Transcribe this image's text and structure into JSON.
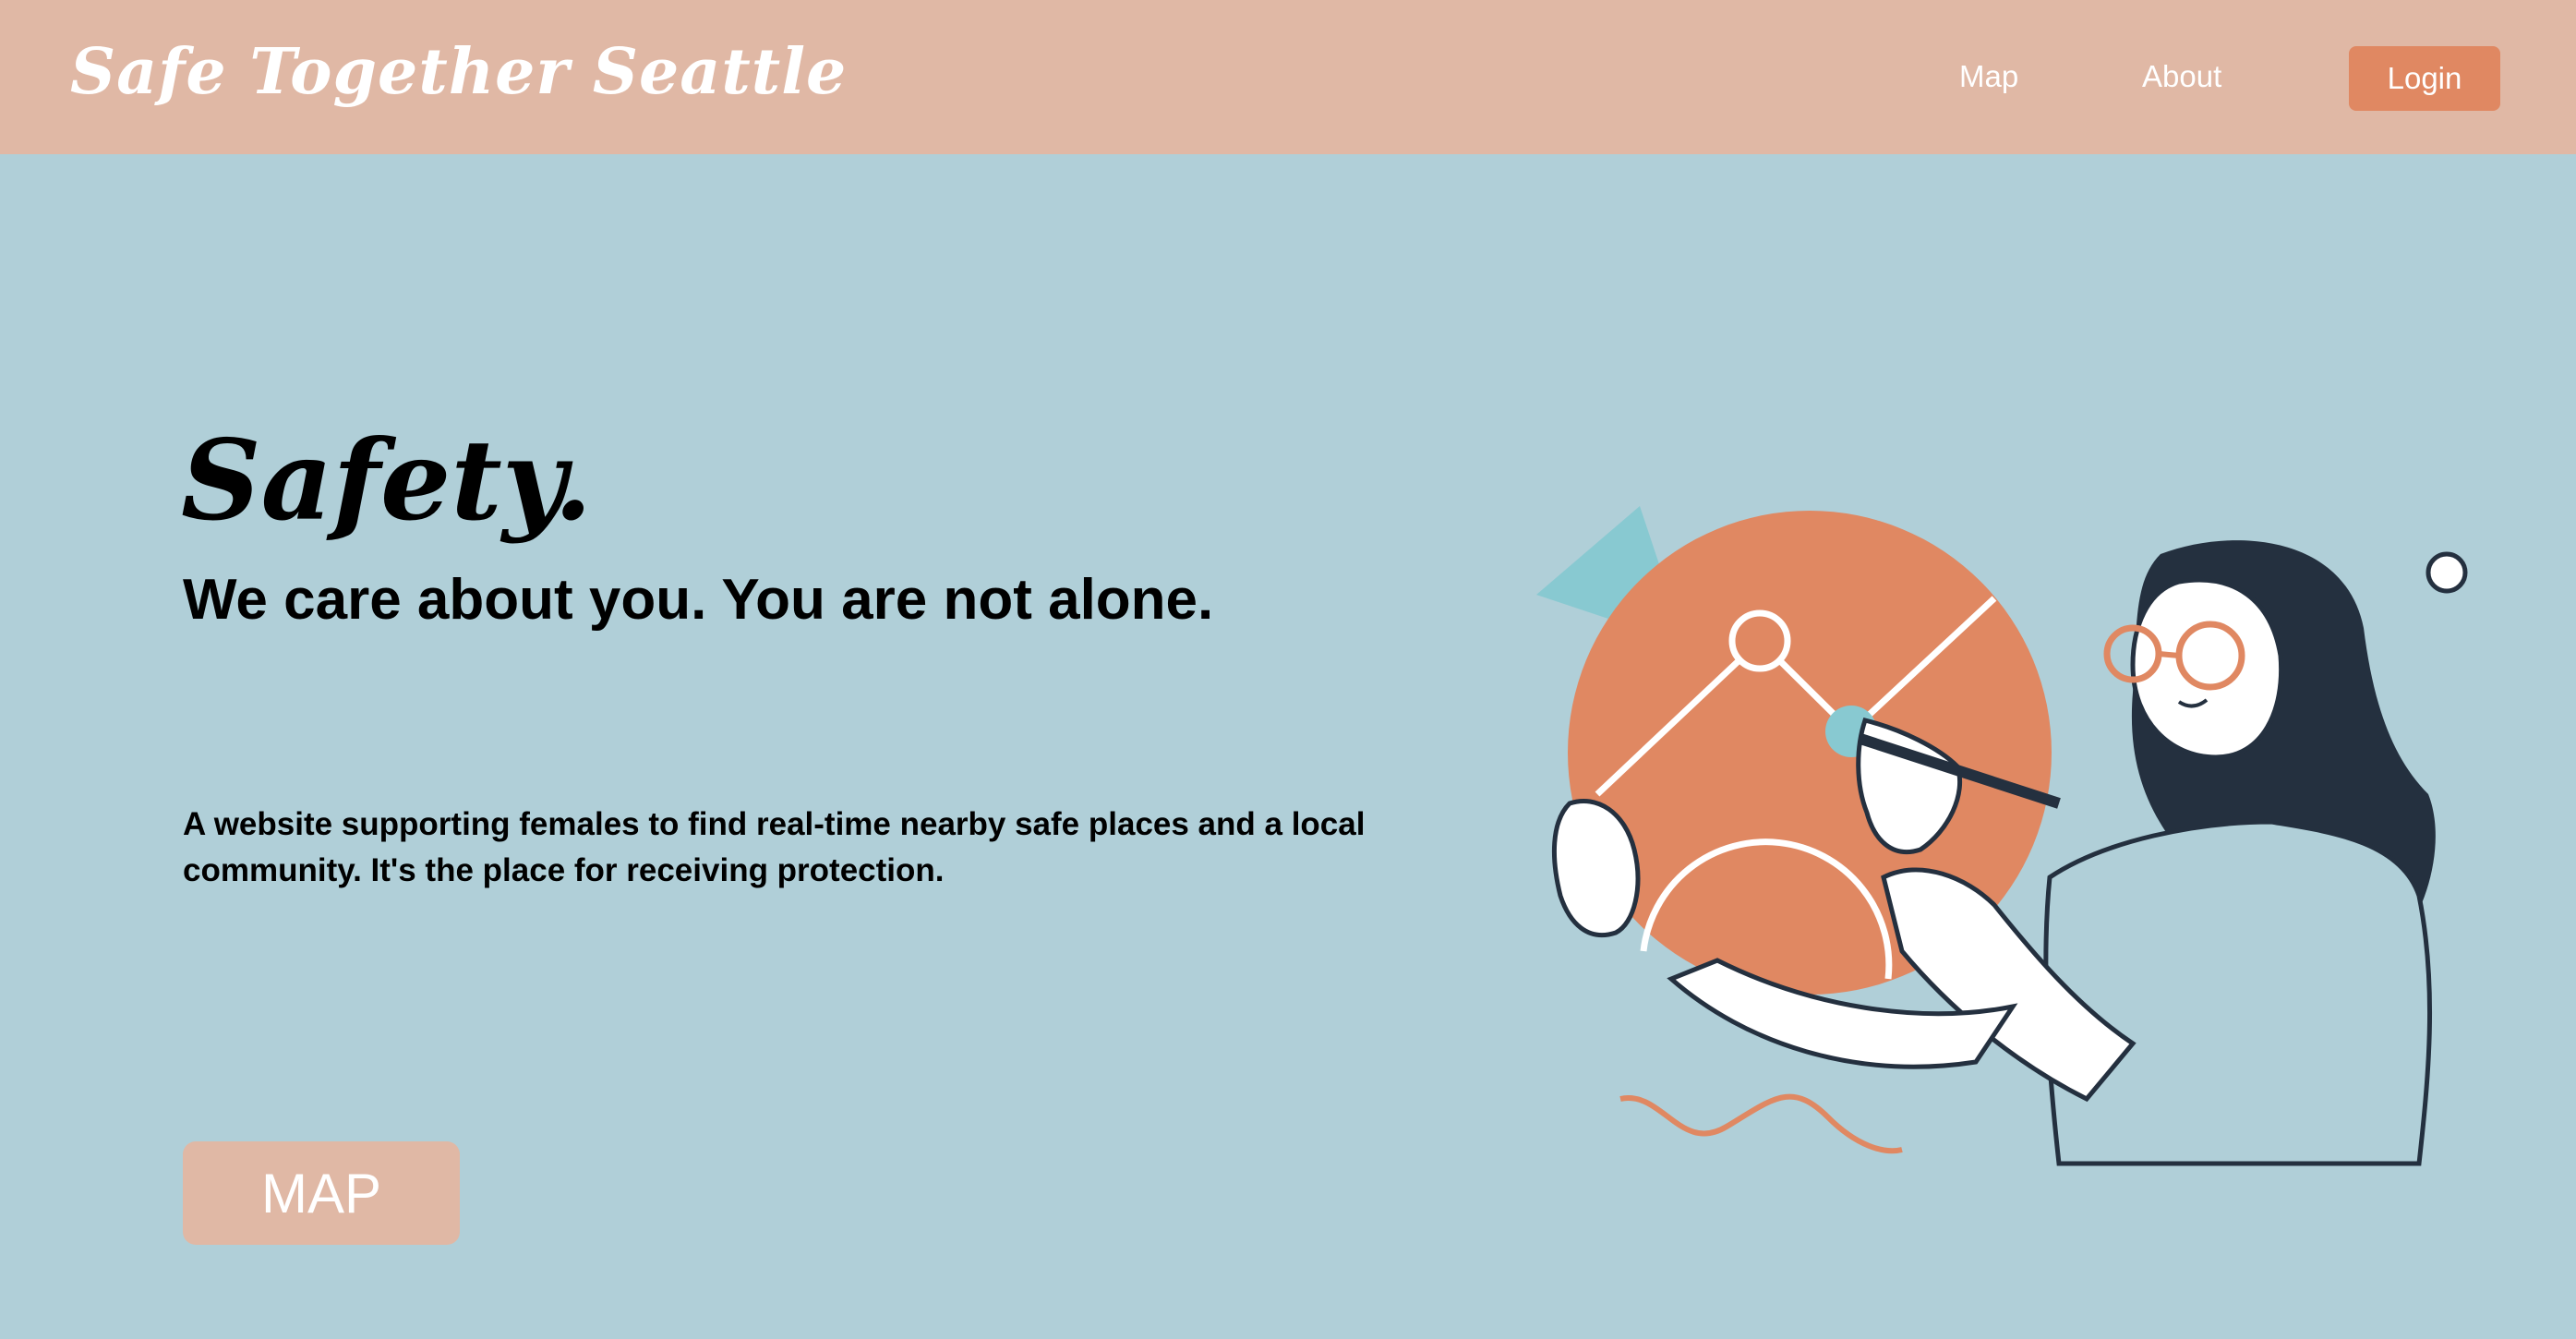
{
  "navbar": {
    "brand": "Safe Together Seattle",
    "links": [
      {
        "label": "Map"
      },
      {
        "label": "About"
      }
    ],
    "login_label": "Login"
  },
  "hero": {
    "heading": "Safety.",
    "subheading": "We care about you. You are not alone.",
    "description": "A website supporting females to find real-time nearby safe places and a local community. It's the place for receiving protection.",
    "map_button_label": "MAP"
  },
  "colors": {
    "navbar_bg": "#e0b8a5",
    "page_bg": "#b0cfd8",
    "accent": "#e08862",
    "teal": "#88c9d1",
    "dark": "#24303f"
  }
}
